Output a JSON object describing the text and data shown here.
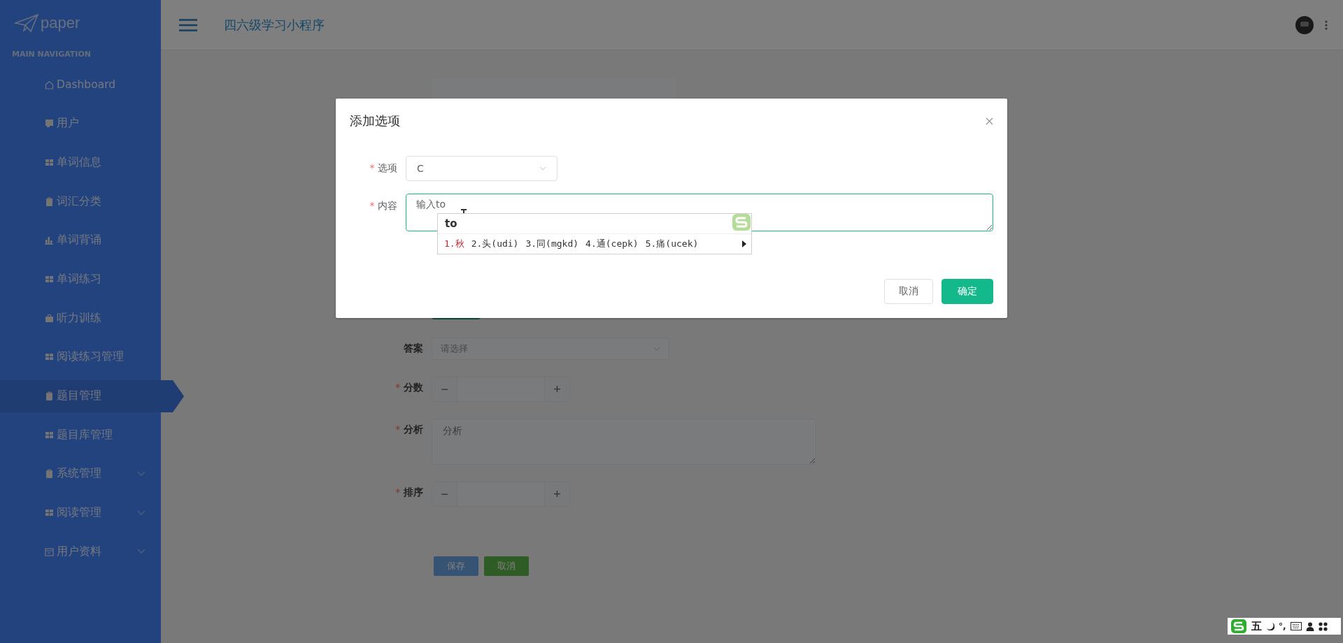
{
  "sidebar": {
    "logo": "paper",
    "section": "MAIN NAVIGATION",
    "items": [
      {
        "label": "Dashboard",
        "kind": "home",
        "selected": false,
        "submenu": false
      },
      {
        "label": "用户",
        "kind": "card",
        "selected": false,
        "submenu": false
      },
      {
        "label": "单词信息",
        "kind": "grid",
        "selected": false,
        "submenu": false
      },
      {
        "label": "词汇分类",
        "kind": "clipboard",
        "selected": false,
        "submenu": false
      },
      {
        "label": "单词背诵",
        "kind": "chart",
        "selected": false,
        "submenu": false
      },
      {
        "label": "单词练习",
        "kind": "grid",
        "selected": false,
        "submenu": false
      },
      {
        "label": "听力训练",
        "kind": "briefcase",
        "selected": false,
        "submenu": false
      },
      {
        "label": "阅读练习管理",
        "kind": "grid",
        "selected": false,
        "submenu": false
      },
      {
        "label": "题目管理",
        "kind": "clipboard",
        "selected": true,
        "submenu": false
      },
      {
        "label": "题目库管理",
        "kind": "grid",
        "selected": false,
        "submenu": false
      },
      {
        "label": "系统管理",
        "kind": "clipboard",
        "selected": false,
        "submenu": true
      },
      {
        "label": "阅读管理",
        "kind": "grid",
        "selected": false,
        "submenu": true
      },
      {
        "label": "用户资料",
        "kind": "calendar",
        "selected": false,
        "submenu": true
      }
    ]
  },
  "header": {
    "title": "四六级学习小程序"
  },
  "form": {
    "fields": [
      {
        "kind": "select",
        "label": "答案",
        "placeholder": "请选择"
      },
      {
        "kind": "number",
        "label": "分数",
        "mark": "*",
        "minus": "−",
        "plus": "+"
      },
      {
        "kind": "textarea",
        "label": "分析",
        "mark": "*",
        "placeholder": "分析"
      },
      {
        "kind": "number",
        "label": "排序",
        "mark": "*",
        "minus": "−",
        "plus": "+"
      }
    ],
    "buttons": [
      {
        "label": "保存",
        "kind": "primary"
      },
      {
        "label": "取消",
        "kind": "success"
      }
    ]
  },
  "dialog": {
    "title": "添加选项",
    "fields": [
      {
        "kind": "select",
        "label": "选项",
        "mark": "*",
        "value": "C"
      },
      {
        "kind": "textarea",
        "label": "内容",
        "mark": "*",
        "value": "输入to"
      }
    ],
    "buttons": [
      {
        "label": "取消",
        "kind": "default"
      },
      {
        "label": "确定",
        "kind": "primary"
      }
    ]
  },
  "ime": {
    "input": "to",
    "candidates": [
      {
        "text": "1.秋",
        "selected": true
      },
      {
        "text": "2.头(udi)",
        "selected": false
      },
      {
        "text": "3.同(mgkd)",
        "selected": false
      },
      {
        "text": "4.通(cepk)",
        "selected": false
      },
      {
        "text": "5.痛(ucek)",
        "selected": false
      }
    ]
  },
  "ime_toolbar": {
    "mode": "五",
    "punctuation": "°,"
  }
}
